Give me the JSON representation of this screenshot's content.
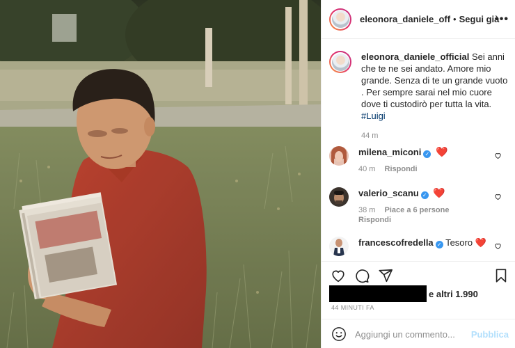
{
  "post": {
    "author": "eleonora_daniele_off",
    "separator": "•",
    "follow_label": "Segui già",
    "more_label": "•••"
  },
  "caption": {
    "username": "eleonora_daniele_official",
    "text": "Sei anni che te ne sei andato. Amore mio grande. Senza di te un grande vuoto . Per sempre sarai nel mio cuore dove ti custodirò per tutta la vita.",
    "hashtag": "#Luigi",
    "time": "44 m"
  },
  "comments": [
    {
      "username": "milena_miconi",
      "verified": true,
      "text": "❤️",
      "time": "40 m",
      "likes": "",
      "reply": "Rispondi"
    },
    {
      "username": "valerio_scanu",
      "verified": true,
      "text": "❤️",
      "time": "38 m",
      "likes": "Piace a 6 persone",
      "reply": "Rispondi"
    },
    {
      "username": "francescofredella",
      "verified": true,
      "text": "Tesoro ❤️",
      "time": "",
      "likes": "",
      "reply": ""
    }
  ],
  "likes": {
    "text": "e altri 1.990"
  },
  "timestamp": "44 MINUTI FA",
  "add_comment": {
    "placeholder": "Aggiungi un commento...",
    "publish_label": "Pubblica"
  },
  "icons": {
    "like": "heart-icon",
    "comment": "comment-icon",
    "share": "share-icon",
    "save": "bookmark-icon",
    "emoji": "emoji-icon",
    "more": "more-icon"
  },
  "colors": {
    "link": "#00376b",
    "verified": "#3897f0",
    "heart": "#ed4956",
    "publish_disabled": "#b2dffc",
    "muted": "#8e8e8e"
  }
}
